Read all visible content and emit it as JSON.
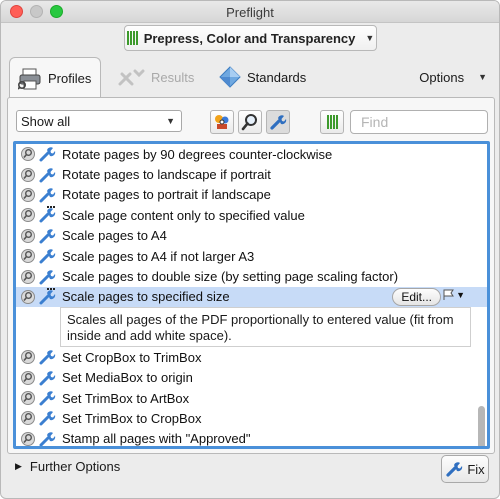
{
  "window": {
    "title": "Preflight"
  },
  "profile_select": {
    "value": "Prepress, Color and Transparency"
  },
  "tabs": {
    "profiles": "Profiles",
    "results": "Results",
    "standards": "Standards",
    "options": "Options"
  },
  "toolbar": {
    "filter_value": "Show all",
    "find_placeholder": "Find"
  },
  "list": {
    "rows_top": [
      {
        "label": "Rotate pages by 90 degrees counter-clockwise"
      },
      {
        "label": "Rotate pages to landscape if portrait"
      },
      {
        "label": "Rotate pages to portrait if landscape"
      },
      {
        "label": "Scale page content only to specified value"
      },
      {
        "label": "Scale pages to A4"
      },
      {
        "label": "Scale pages to A4 if not larger A3"
      },
      {
        "label": "Scale pages to double size (by setting page scaling factor)"
      }
    ],
    "selected": {
      "label": "Scale pages to specified size",
      "edit_label": "Edit...",
      "description": "Scales all pages of the PDF proportionally to entered value (fit from inside and add white space)."
    },
    "rows_bottom": [
      {
        "label": "Set CropBox to TrimBox"
      },
      {
        "label": "Set MediaBox to origin"
      },
      {
        "label": "Set TrimBox to ArtBox"
      },
      {
        "label": "Set TrimBox to CropBox"
      },
      {
        "label": "Stamp all pages with \"Approved\""
      }
    ]
  },
  "footer": {
    "further_options": "Further Options",
    "fix_label": "Fix"
  },
  "colors": {
    "accent_blue": "#4a90d9",
    "selection": "#c7dbf7",
    "green": "#3d9a2c"
  }
}
